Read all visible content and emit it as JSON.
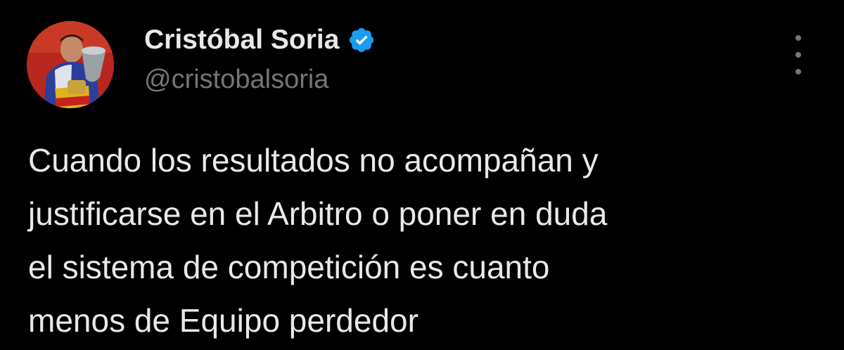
{
  "tweet": {
    "author": {
      "display_name": "Cristóbal Soria",
      "handle": "@cristobalsoria",
      "verified": true
    },
    "text": "Cuando los resultados no acompañan y\njustificarse en el Arbitro o poner en duda\nel sistema de competición es cuanto\nmenos de Equipo perdedor",
    "more_icon": "more-vertical-icon"
  },
  "colors": {
    "background": "#000000",
    "text_primary": "#e7e9ea",
    "text_secondary": "#71767b",
    "verified_badge": "#1d9bf0"
  }
}
